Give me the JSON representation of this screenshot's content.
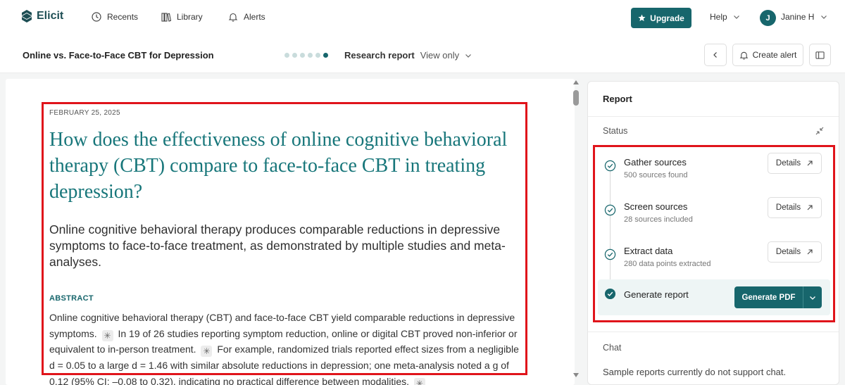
{
  "app": {
    "name": "Elicit"
  },
  "nav": {
    "recents": "Recents",
    "library": "Library",
    "alerts": "Alerts",
    "upgrade": "Upgrade",
    "help": "Help",
    "user_initial": "J",
    "user_name": "Janine H"
  },
  "subheader": {
    "title": "Online vs. Face-to-Face CBT for Depression",
    "mode": "Research report",
    "view": "View only",
    "create_alert": "Create alert"
  },
  "document": {
    "date": "FEBRUARY 25, 2025",
    "headline": "How does the effectiveness of online cognitive behavioral therapy (CBT) compare to face-to-face CBT in treating depression?",
    "lede": "Online cognitive behavioral therapy produces comparable reductions in depressive symptoms to face-to-face treatment, as demonstrated by multiple studies and meta-analyses.",
    "abstract_label": "ABSTRACT",
    "abstract_parts": [
      "Online cognitive behavioral therapy (CBT) and face-to-face CBT yield comparable reductions in depressive symptoms.",
      "In 19 of 26 studies reporting symptom reduction, online or digital CBT proved non-inferior or equivalent to in-person treatment.",
      "For example, randomized trials reported effect sizes from a negligible d = 0.05 to a large d = 1.46 with similar absolute reductions in depression; one meta-analysis noted a g of 0.12 (95% CI: –0.08 to 0.32), indicating no practical difference between modalities."
    ],
    "citation_glyph": "✳"
  },
  "sidepanel": {
    "title": "Report",
    "status_label": "Status",
    "steps": [
      {
        "title": "Gather sources",
        "subtitle": "500 sources found",
        "action": "Details"
      },
      {
        "title": "Screen sources",
        "subtitle": "28 sources included",
        "action": "Details"
      },
      {
        "title": "Extract data",
        "subtitle": "280 data points extracted",
        "action": "Details"
      }
    ],
    "generate": {
      "title": "Generate report",
      "button": "Generate PDF"
    },
    "chat_label": "Chat",
    "chat_note": "Sample reports currently do not support chat."
  },
  "colors": {
    "accent": "#17666c",
    "headline": "#17767a",
    "highlight": "#e0141b"
  }
}
